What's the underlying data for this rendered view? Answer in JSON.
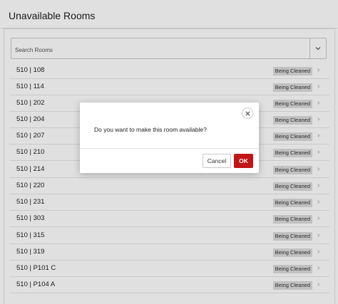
{
  "page": {
    "title": "Unavailable Rooms"
  },
  "search": {
    "placeholder": "Search Rooms"
  },
  "rooms": [
    {
      "name": "510 | 108",
      "status": "Being Cleaned"
    },
    {
      "name": "510 | 114",
      "status": "Being Cleaned"
    },
    {
      "name": "510 | 202",
      "status": "Being Cleaned"
    },
    {
      "name": "510 | 204",
      "status": "Being Cleaned"
    },
    {
      "name": "510 | 207",
      "status": "Being Cleaned"
    },
    {
      "name": "510 | 210",
      "status": "Being Cleaned"
    },
    {
      "name": "510 | 214",
      "status": "Being Cleaned"
    },
    {
      "name": "510 | 220",
      "status": "Being Cleaned"
    },
    {
      "name": "510 | 231",
      "status": "Being Cleaned"
    },
    {
      "name": "510 | 303",
      "status": "Being Cleaned"
    },
    {
      "name": "510 | 315",
      "status": "Being Cleaned"
    },
    {
      "name": "510 | 319",
      "status": "Being Cleaned"
    },
    {
      "name": "510 | P101 C",
      "status": "Being Cleaned"
    },
    {
      "name": "510 | P104 A",
      "status": "Being Cleaned"
    }
  ],
  "dialog": {
    "message": "Do you want to make this room available?",
    "cancel_label": "Cancel",
    "ok_label": "OK"
  },
  "colors": {
    "primary_button": "#c11515",
    "badge_background": "#dcdcdc",
    "overlay": "#000000"
  },
  "icons": {
    "search_toggle": "chevron-down-icon",
    "row": "chevron-right-icon",
    "close": "close-icon"
  }
}
